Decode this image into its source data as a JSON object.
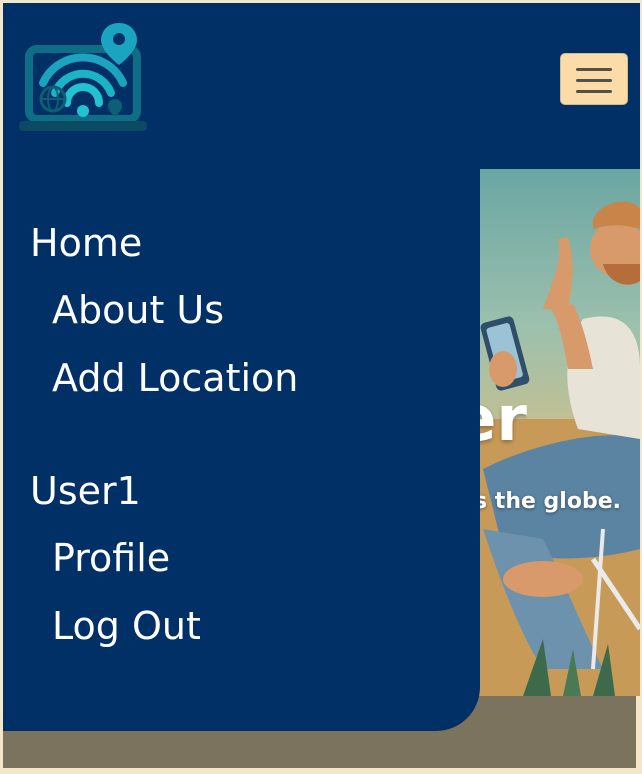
{
  "header": {
    "logo_icon": "wifi-laptop-location-icon",
    "menu_icon": "hamburger-menu-icon"
  },
  "hero": {
    "title": "er",
    "subtitle": "s the globe."
  },
  "drawer": {
    "items": [
      {
        "label": "Home"
      },
      {
        "label": "About Us"
      },
      {
        "label": "Add Location"
      },
      {
        "label": "User1"
      },
      {
        "label": "Profile"
      },
      {
        "label": "Log Out"
      }
    ]
  },
  "colors": {
    "nav_background": "#003066",
    "menu_button": "#fbdca8",
    "page_background": "#f4e6c8",
    "footer_strip": "#7b735e"
  }
}
